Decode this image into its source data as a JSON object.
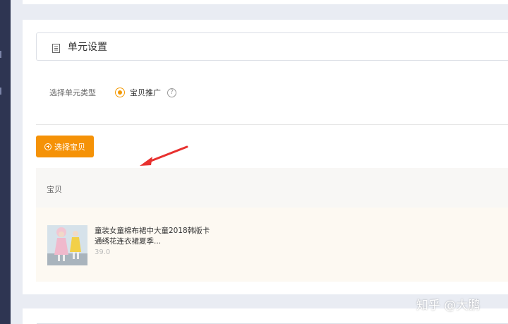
{
  "section": {
    "title": "单元设置",
    "icon": "document-icon"
  },
  "unit_type": {
    "label": "选择单元类型",
    "option_label": "宝贝推广",
    "selected": true,
    "help_icon": "?"
  },
  "toolbar": {
    "select_label": "选择宝贝",
    "select_icon": "plus-circle-icon"
  },
  "table": {
    "column_header": "宝贝",
    "rows": [
      {
        "name": "童装女童棉布裙中大童2018韩版卡通绣花连衣裙夏季...",
        "price": "39.0"
      }
    ]
  },
  "watermark": "知乎 @大鹏",
  "colors": {
    "accent": "#f59207",
    "sidebar": "#2e3552",
    "arrow": "#e8312f",
    "table_bg": "#fdf9f2"
  }
}
